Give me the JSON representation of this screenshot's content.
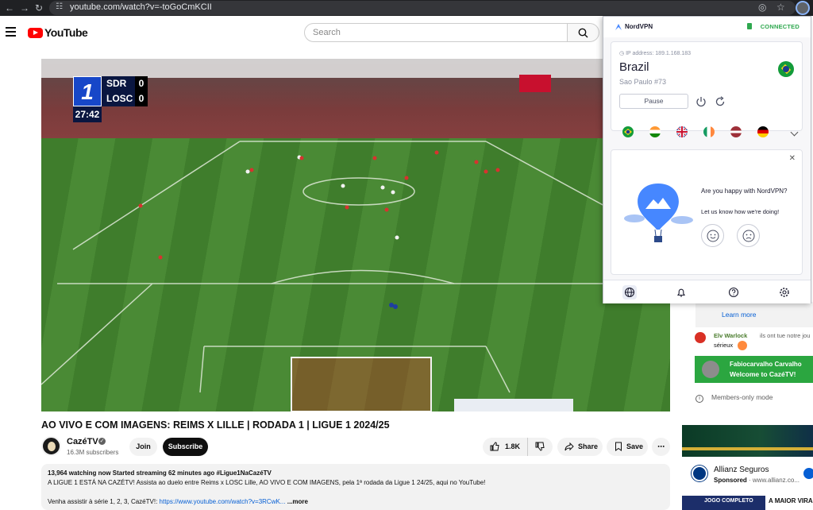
{
  "browser": {
    "url": "youtube.com/watch?v=-toGoCmKCII"
  },
  "youtube": {
    "logo_text": "YouTube",
    "search_placeholder": "Search"
  },
  "video": {
    "scoreboard": {
      "home_team": "SDR",
      "home_score": "0",
      "away_team": "LOSC",
      "away_score": "0",
      "clock": "27:42"
    },
    "title": "AO VIVO E COM IMAGENS: REIMS X LILLE | RODADA 1 | LIGUE 1 2024/25",
    "channel": {
      "name": "CazéTV",
      "subscribers": "16.3M subscribers"
    },
    "actions": {
      "join": "Join",
      "subscribe": "Subscribe",
      "likes": "1.8K",
      "share": "Share",
      "save": "Save"
    },
    "description": {
      "stats": "13,964 watching now  Started streaming 62 minutes ago  #Ligue1NaCazéTV",
      "line1": "A LIGUE 1 ESTÁ NA CAZÉTV! Assista ao duelo entre Reims x LOSC Lille, AO VIVO E COM IMAGENS, pela 1ª rodada da Ligue 1 24/25, aqui no YouTube!",
      "line2_prefix": "Venha assistir à série 1, 2, 3, CazéTV!: ",
      "line2_link": "https://www.youtube.com/watch?v=3RCwK...",
      "more": "...more"
    }
  },
  "chat": {
    "learn_more": "Learn more",
    "message": {
      "author": "Elv Warlock",
      "text": "ils ont tue notre jou",
      "text2": "sérieux"
    },
    "member": {
      "name": "Fabiocarvalho Carvalho",
      "text": "Welcome to CazéTV!"
    },
    "members_only": "Members-only mode"
  },
  "ad": {
    "title": "Allianz Seguros",
    "sponsored": "Sponsored",
    "domain": "www.allianz.co...",
    "next_thumb_text": "JOGO COMPLETO",
    "next_title": "A MAIOR VIRA BARBOSA NA"
  },
  "nordvpn": {
    "brand": "NordVPN",
    "status": "CONNECTED",
    "ip": "IP address: 189.1.168.183",
    "country": "Brazil",
    "city": "Sao Paulo #73",
    "pause": "Pause",
    "feedback_question": "Are you happy with NordVPN?",
    "feedback_sub": "Let us know how we're doing!",
    "flags": [
      "brazil",
      "india",
      "uk",
      "ireland",
      "latvia",
      "germany"
    ]
  },
  "colors": {
    "yt_red": "#ff0000",
    "nord_blue": "#4687ff",
    "connected_green": "#2fa84f",
    "member_green": "#2ba640",
    "link_blue": "#065fd4"
  }
}
